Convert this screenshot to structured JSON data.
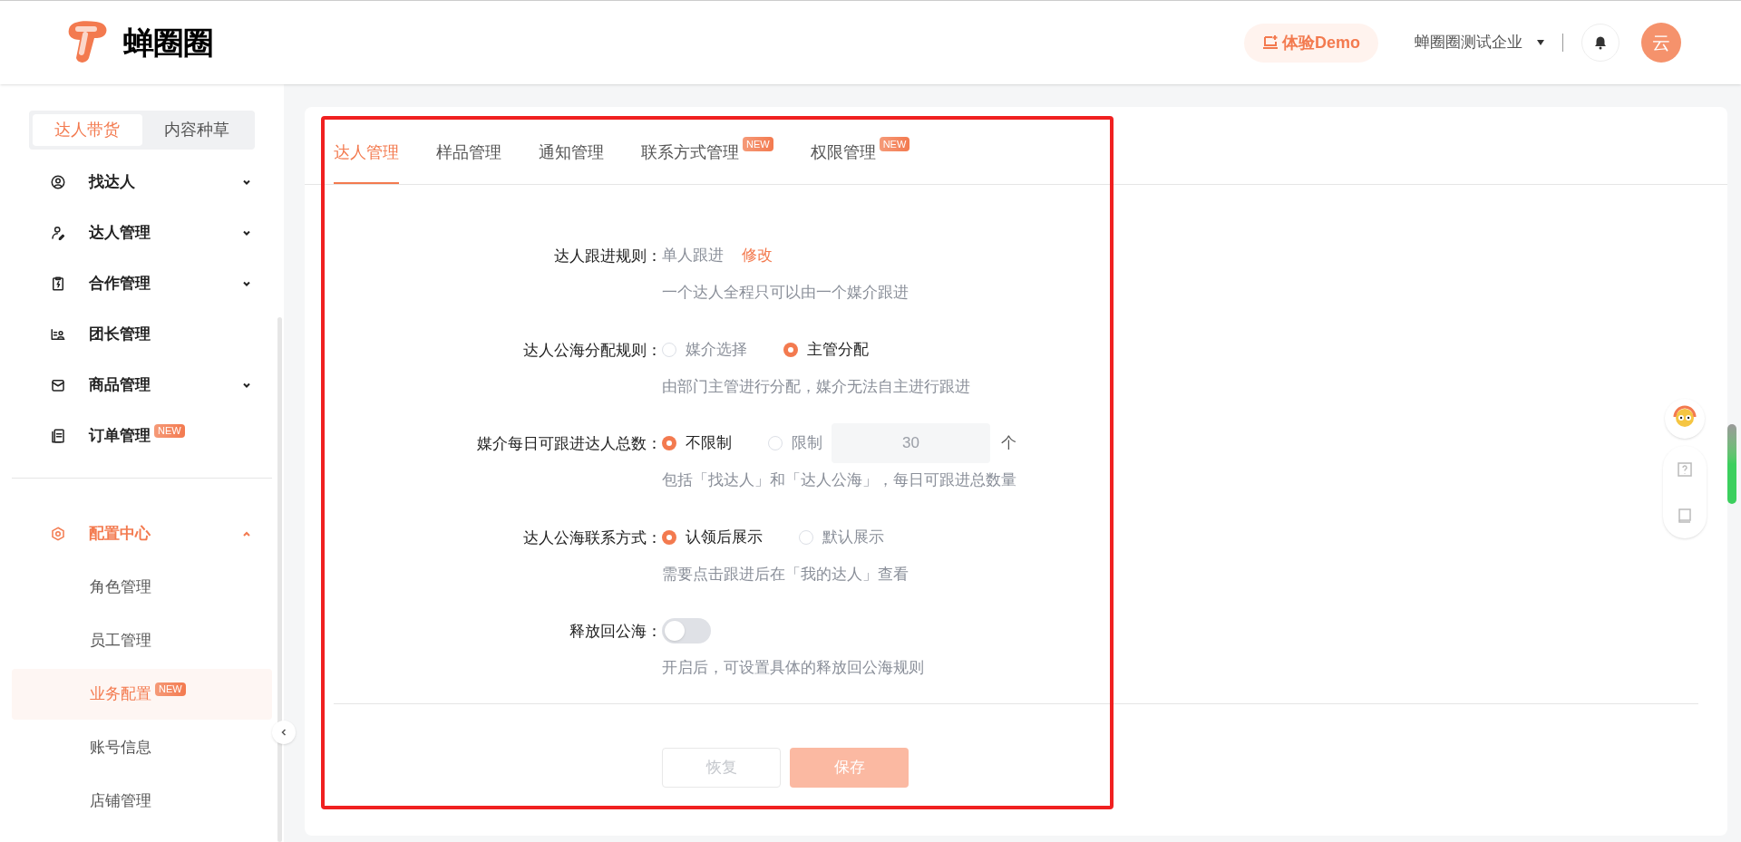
{
  "header": {
    "logo_text": "蝉圈圈",
    "demo_button": "体验Demo",
    "company": "蝉圈圈测试企业",
    "avatar": "云"
  },
  "sidebar": {
    "mode_tabs": [
      {
        "label": "达人带货",
        "selected": true
      },
      {
        "label": "内容种草",
        "selected": false
      }
    ],
    "items": [
      {
        "label": "找达人",
        "expandable": true,
        "expanded": false
      },
      {
        "label": "达人管理",
        "expandable": true,
        "expanded": false
      },
      {
        "label": "合作管理",
        "expandable": true,
        "expanded": false
      },
      {
        "label": "团长管理",
        "expandable": false,
        "expanded": false
      },
      {
        "label": "商品管理",
        "expandable": true,
        "expanded": false
      },
      {
        "label": "订单管理",
        "expandable": false,
        "expanded": false,
        "badge": "NEW"
      }
    ],
    "config": {
      "label": "配置中心",
      "expanded": true,
      "children": [
        {
          "label": "角色管理",
          "selected": false
        },
        {
          "label": "员工管理",
          "selected": false
        },
        {
          "label": "业务配置",
          "selected": true,
          "badge": "NEW"
        },
        {
          "label": "账号信息",
          "selected": false
        },
        {
          "label": "店铺管理",
          "selected": false
        }
      ]
    }
  },
  "tabs": [
    {
      "label": "达人管理",
      "selected": true
    },
    {
      "label": "样品管理",
      "selected": false
    },
    {
      "label": "通知管理",
      "selected": false
    },
    {
      "label": "联系方式管理",
      "selected": false,
      "badge": "NEW"
    },
    {
      "label": "权限管理",
      "selected": false,
      "badge": "NEW"
    }
  ],
  "form": [
    {
      "kind": "text",
      "label": "达人跟进规则：",
      "value": "单人跟进",
      "link": "修改",
      "help": "一个达人全程只可以由一个媒介跟进"
    },
    {
      "kind": "radio",
      "label": "达人公海分配规则：",
      "options": [
        {
          "label": "媒介选择",
          "selected": false
        },
        {
          "label": "主管分配",
          "selected": true
        }
      ],
      "help": "由部门主管进行分配，媒介无法自主进行跟进"
    },
    {
      "kind": "radio",
      "label": "媒介每日可跟进达人总数：",
      "options": [
        {
          "label": "不限制",
          "selected": true
        },
        {
          "label": "限制",
          "selected": false
        }
      ],
      "input": {
        "placeholder": "30",
        "unit": "个"
      },
      "help": "包括「找达人」和「达人公海」，每日可跟进总数量"
    },
    {
      "kind": "radio",
      "label": "达人公海联系方式：",
      "options": [
        {
          "label": "认领后展示",
          "selected": true
        },
        {
          "label": "默认展示",
          "selected": false
        }
      ],
      "help": "需要点击跟进后在「我的达人」查看"
    },
    {
      "kind": "switch",
      "label": "释放回公海：",
      "on": false,
      "help": "开启后，可设置具体的释放回公海规则"
    }
  ],
  "buttons": {
    "reset": {
      "label": "恢复",
      "disabled": true
    },
    "save": {
      "label": "保存",
      "disabled": true
    }
  }
}
